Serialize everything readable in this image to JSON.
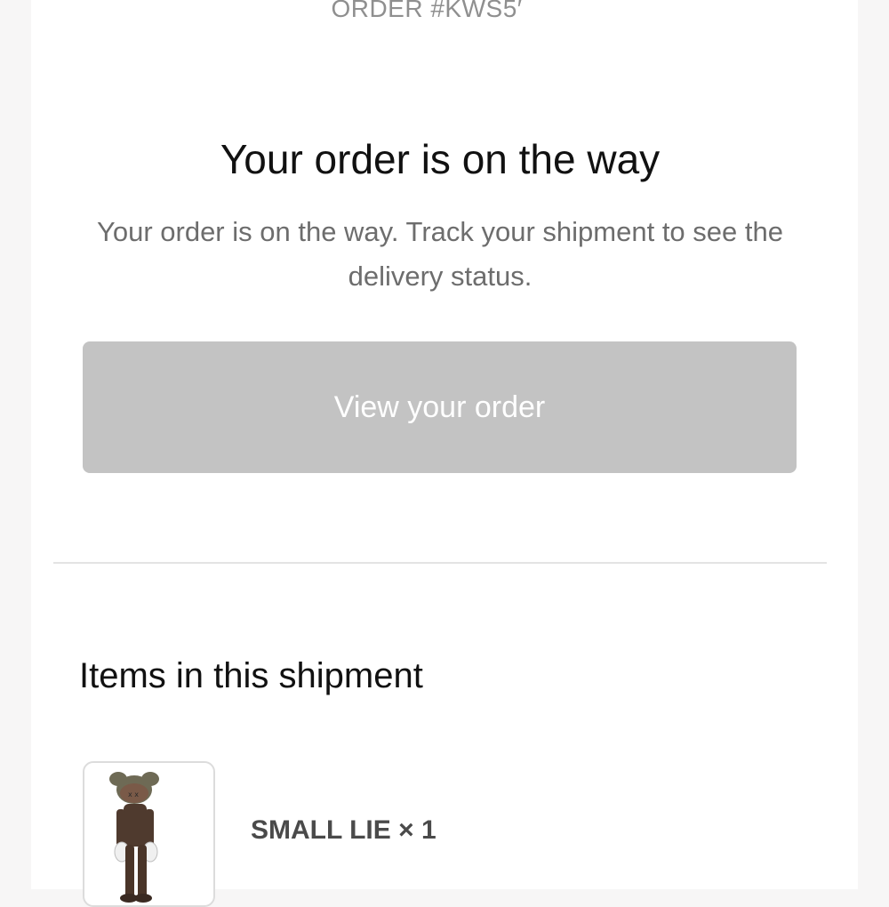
{
  "header": {
    "order_number": "ORDER #KWS5′"
  },
  "notice": {
    "title": "Your order is on the way",
    "message": "Your order is on the way. Track your shipment to see the delivery status."
  },
  "actions": {
    "view_order_label": "View your order"
  },
  "shipment": {
    "section_title": "Items in this shipment",
    "items": [
      {
        "name": "SMALL LIE",
        "quantity_label": "× 1",
        "image_icon": "figure-thumbnail"
      }
    ]
  },
  "colors": {
    "button_bg": "#c3c3c3",
    "button_text": "#ffffff",
    "title_text": "#111111",
    "body_text": "#6d6d6d",
    "divider": "#e3e3e3"
  }
}
